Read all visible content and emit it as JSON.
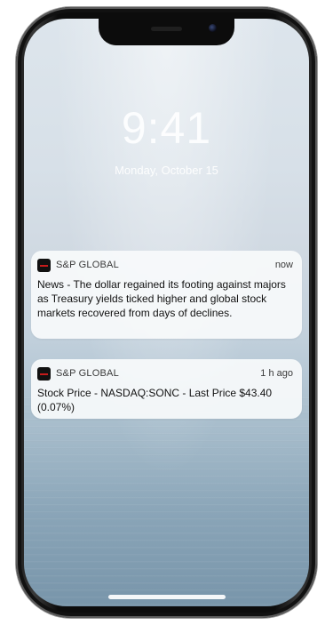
{
  "lock_screen": {
    "time": "9:41",
    "date": "Monday, October 15"
  },
  "notifications": [
    {
      "app": "S&P GLOBAL",
      "time": "now",
      "body": "News - The dollar regained its footing against majors as Treasury yields ticked higher and global stock markets recovered from days of declines.",
      "icon": "sp-global-app-icon"
    },
    {
      "app": "S&P GLOBAL",
      "time": "1 h ago",
      "body": "Stock Price - NASDAQ:SONC - Last Price $43.40 (0.07%)",
      "icon": "sp-global-app-icon"
    }
  ],
  "colors": {
    "icon_background": "#111111",
    "icon_accent": "#c61b1b",
    "wallpaper_top": "#dde5ec",
    "wallpaper_bottom": "#7895aa"
  }
}
